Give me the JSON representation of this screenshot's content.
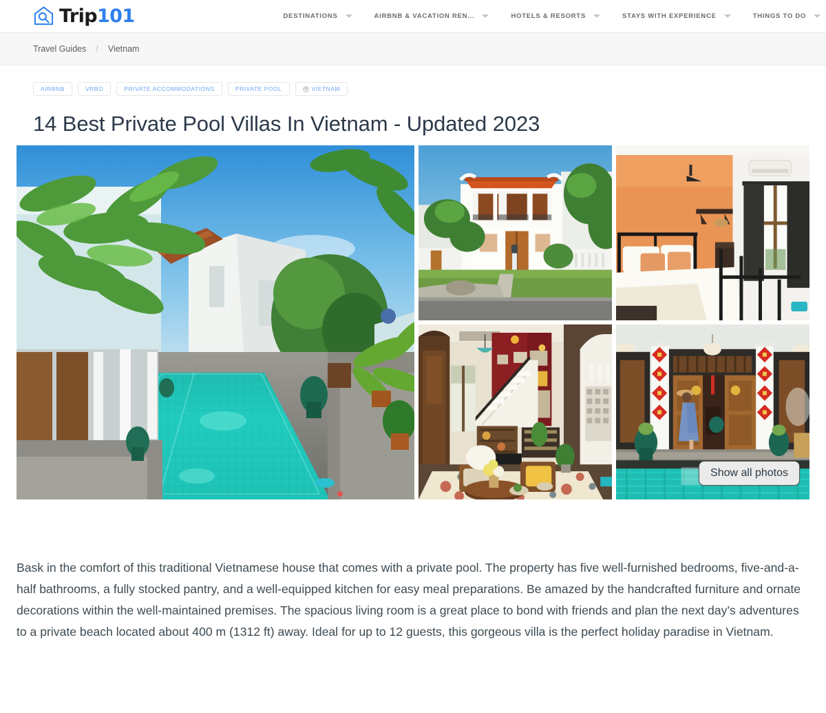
{
  "brand": {
    "logo_icon": "house-search-logo-icon",
    "name_dark": "Trip",
    "name_accent": "101",
    "accent_color": "#2f80ed"
  },
  "nav": {
    "items": [
      {
        "label": "DESTINATIONS",
        "has_caret": true
      },
      {
        "label": "AIRBNB & VACATION REN...",
        "has_caret": true
      },
      {
        "label": "HOTELS & RESORTS",
        "has_caret": true
      },
      {
        "label": "STAYS WITH EXPERIENCE",
        "has_caret": true
      },
      {
        "label": "THINGS TO DO",
        "has_caret": true
      }
    ],
    "search_icon": "search-icon",
    "account_icon": "user-account-icon"
  },
  "breadcrumb": {
    "items": [
      "Travel Guides",
      "Vietnam"
    ],
    "separator": "/"
  },
  "tags": [
    {
      "label": "AIRBNB",
      "icon": null
    },
    {
      "label": "VRBO",
      "icon": null
    },
    {
      "label": "PRIVATE ACCOMMODATIONS",
      "icon": null
    },
    {
      "label": "PRIVATE POOL",
      "icon": null
    },
    {
      "label": "VIETNAM",
      "icon": "location-pin-icon"
    }
  ],
  "article": {
    "title": "14 Best Private Pool Villas In Vietnam - Updated 2023",
    "paragraph": "Bask in the comfort of this traditional Vietnamese house that comes with a private pool. The property has five well-furnished bedrooms, five-and-a-half bathrooms, a fully stocked pantry, and a well-equipped kitchen for easy meal preparations. Be amazed by the handcrafted furniture and ornate decorations within the well-maintained premises. The spacious living room is a great place to bond with friends and plan the next day’s adventures to a private beach located about 400 m (1312 ft) away. Ideal for up to 12 guests, this gorgeous villa is the perfect holiday paradise in Vietnam."
  },
  "gallery": {
    "show_all_label": "Show all photos",
    "main_photo_alt": "Long turquoise mosaic-tiled private pool between a white villa colonnade and tropical potted plants under blue sky",
    "thumbnails": [
      {
        "alt": "White colonial villa exterior with orange tile roof, wooden doors and a person standing on the lawn"
      },
      {
        "alt": "Bedroom with terracotta orange accent wall, black metal bed frame, white bedding and orange cushions"
      },
      {
        "alt": "Living room with staircase, dark red gallery wall, patterned tile floor and wooden armchairs"
      },
      {
        "alt": "Woman in a blue dress and straw hat walking past wooden doors decorated with red Tet banners beside the pool"
      }
    ]
  }
}
